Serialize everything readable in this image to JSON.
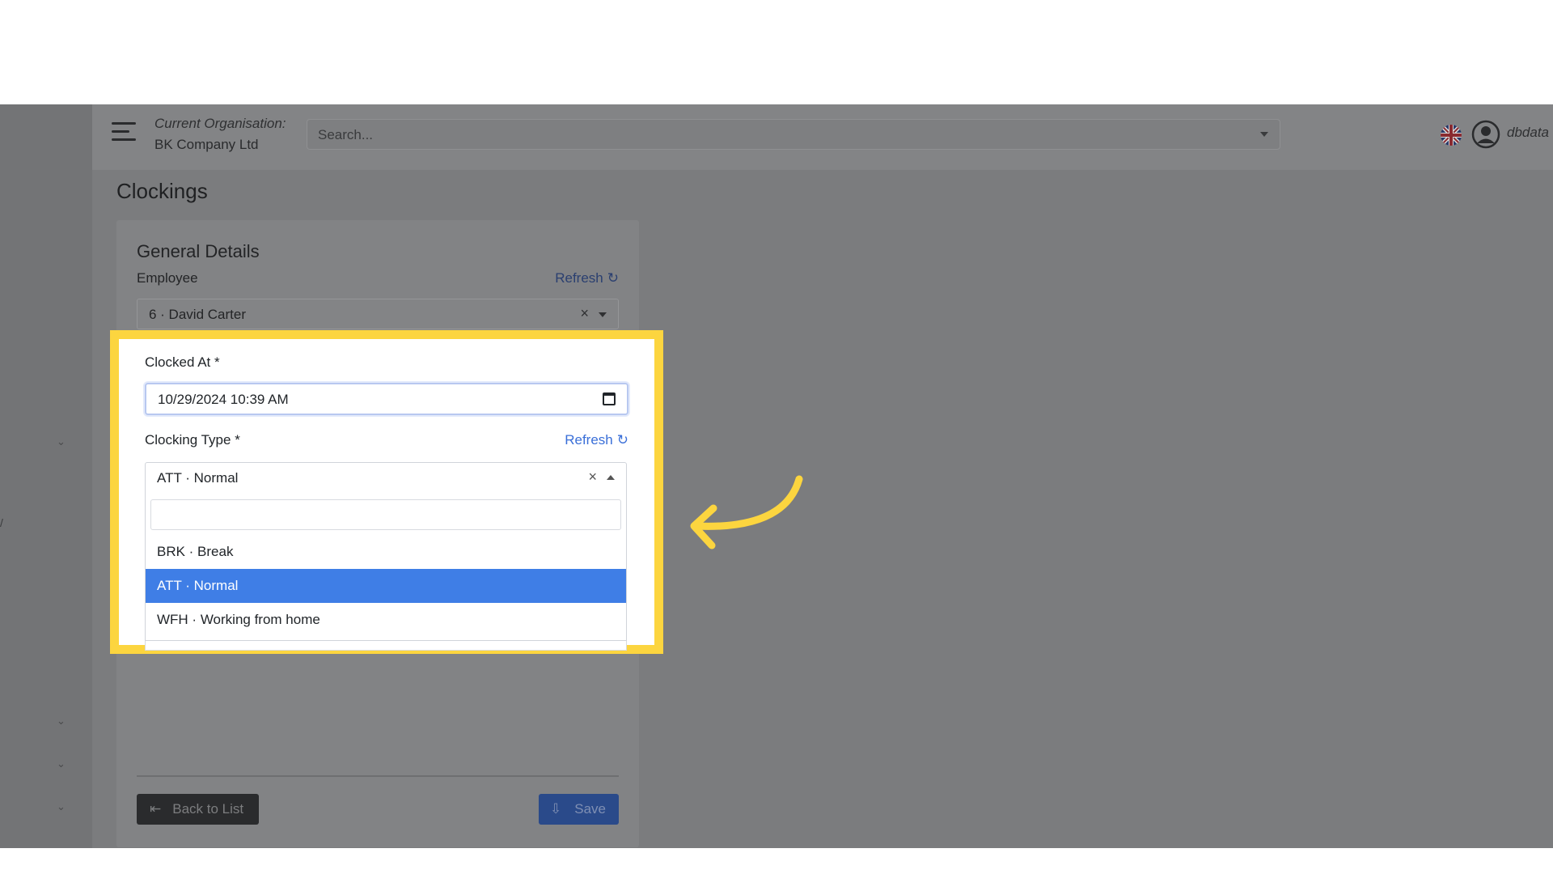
{
  "topbar": {
    "org_label": "Current Organisation:",
    "org_name": "BK Company Ltd",
    "search_placeholder": "Search...",
    "username": "dbdata"
  },
  "page": {
    "title": "Clockings"
  },
  "card": {
    "title": "General Details",
    "employee": {
      "label": "Employee",
      "refresh": "Refresh",
      "value": "6 · David Carter"
    },
    "clocked_at": {
      "label": "Clocked At *",
      "value": "10/29/2024 10:39  AM"
    },
    "clocking_type": {
      "label": "Clocking Type *",
      "refresh": "Refresh",
      "value": "ATT · Normal",
      "options": [
        {
          "label": "BRK · Break",
          "selected": false
        },
        {
          "label": "ATT · Normal",
          "selected": true
        },
        {
          "label": "WFH · Working from home",
          "selected": false
        }
      ]
    },
    "back_button": "Back to List",
    "save_button": "Save"
  },
  "colors": {
    "highlight": "#fcd53f",
    "selected_option": "#3f7ee6",
    "link": "#3a6fd8"
  }
}
